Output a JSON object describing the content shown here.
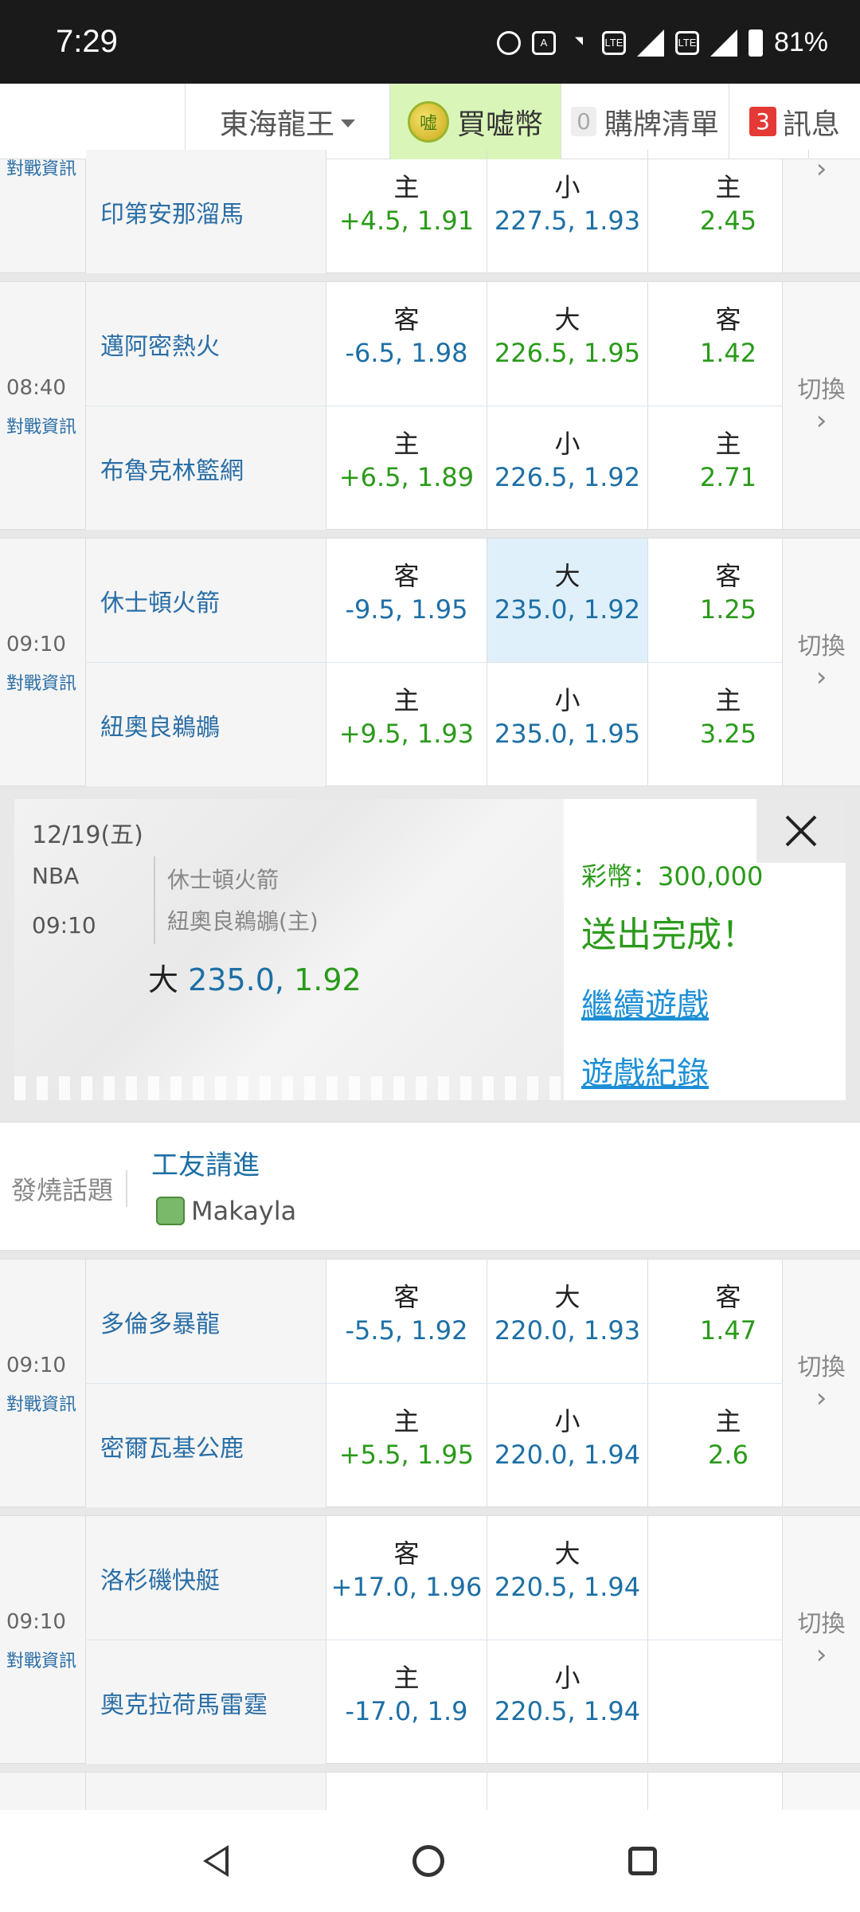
{
  "status": {
    "time": "7:29",
    "battery": "81%"
  },
  "topnav": {
    "user": "東海龍王",
    "coin_icon_text": "嘘",
    "buy": "買嘘幣",
    "cart_count": "0",
    "cart": "購牌清單",
    "msg_count": "3",
    "msg": "訊息"
  },
  "vs_label": "對戰資訊",
  "switch_label": "切換",
  "games": [
    {
      "time": "",
      "away": {
        "team": "",
        "spread_label": "",
        "spread": "",
        "total_label": "",
        "total": "",
        "ml_label": "",
        "ml": ""
      },
      "home": {
        "team": "印第安那溜馬",
        "spread_label": "主",
        "spread": "+4.5, 1.91",
        "total_label": "小",
        "total": "227.5, 1.93",
        "ml_label": "主",
        "ml": "2.45"
      }
    },
    {
      "time": "08:40",
      "away": {
        "team": "邁阿密熱火",
        "spread_label": "客",
        "spread": "-6.5, 1.98",
        "total_label": "大",
        "total": "226.5, 1.95",
        "ml_label": "客",
        "ml": "1.42"
      },
      "home": {
        "team": "布魯克林籃網",
        "spread_label": "主",
        "spread": "+6.5, 1.89",
        "total_label": "小",
        "total": "226.5, 1.92",
        "ml_label": "主",
        "ml": "2.71"
      }
    },
    {
      "time": "09:10",
      "away": {
        "team": "休士頓火箭",
        "spread_label": "客",
        "spread": "-9.5, 1.95",
        "total_label": "大",
        "total": "235.0, 1.92",
        "ml_label": "客",
        "ml": "1.25"
      },
      "home": {
        "team": "紐奧良鵜鶘",
        "spread_label": "主",
        "spread": "+9.5, 1.93",
        "total_label": "小",
        "total": "235.0, 1.95",
        "ml_label": "主",
        "ml": "3.25"
      }
    },
    {
      "time": "09:10",
      "away": {
        "team": "多倫多暴龍",
        "spread_label": "客",
        "spread": "-5.5, 1.92",
        "total_label": "大",
        "total": "220.0, 1.93",
        "ml_label": "客",
        "ml": "1.47"
      },
      "home": {
        "team": "密爾瓦基公鹿",
        "spread_label": "主",
        "spread": "+5.5, 1.95",
        "total_label": "小",
        "total": "220.0, 1.94",
        "ml_label": "主",
        "ml": "2.6"
      }
    },
    {
      "time": "09:10",
      "away": {
        "team": "洛杉磯快艇",
        "spread_label": "客",
        "spread": "+17.0, 1.96",
        "total_label": "大",
        "total": "220.5, 1.94",
        "ml_label": "",
        "ml": ""
      },
      "home": {
        "team": "奧克拉荷馬雷霆",
        "spread_label": "主",
        "spread": "-17.0, 1.9",
        "total_label": "小",
        "total": "220.5, 1.94",
        "ml_label": "",
        "ml": ""
      }
    }
  ],
  "popup": {
    "date": "12/19(五)",
    "league": "NBA",
    "time": "09:10",
    "team1": "休士頓火箭",
    "team2": "紐奧良鵜鶘(主)",
    "pick_label": "大",
    "pick_line": "235.0,",
    "pick_odds": "1.92",
    "coins": "彩幣：300,000",
    "done": "送出完成！",
    "continue": "繼續遊戲",
    "history": "遊戲紀錄"
  },
  "topic": {
    "label": "發燒話題",
    "title": "工友請進",
    "user": "Makayla"
  }
}
